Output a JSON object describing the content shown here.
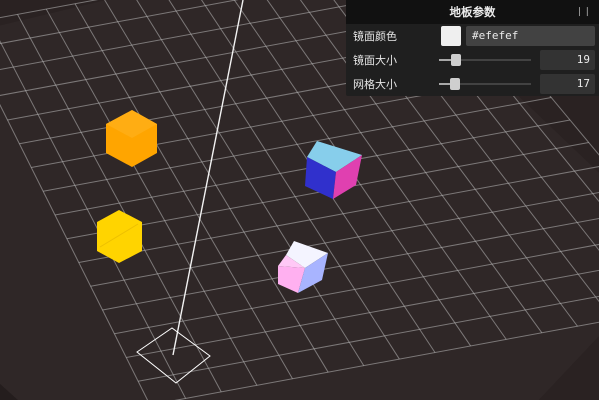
{
  "panel": {
    "title": "地板参数",
    "collapse_icon": "collapse-icon",
    "mirror_color": {
      "label": "镜面颜色",
      "value": "#efefef"
    },
    "mirror_size": {
      "label": "镜面大小",
      "value": "19",
      "level": 0.19
    },
    "grid_size": {
      "label": "网格大小",
      "value": "17",
      "level": 0.17
    }
  },
  "scene": {
    "floor_color": "#2f2727",
    "grid_color": "#bcbcbc",
    "background_color": "#2a2222",
    "objects": [
      {
        "name": "orange-hexagon",
        "color": "#ffa500"
      },
      {
        "name": "yellow-hexagon",
        "color": "#ffd400"
      },
      {
        "name": "blue-magenta-cube",
        "colors": [
          "#87ceeb",
          "#3030cc",
          "#e040b0"
        ]
      },
      {
        "name": "pink-white-cube",
        "colors": [
          "#f4f4ff",
          "#ffb0f0",
          "#a8b4ff"
        ]
      }
    ]
  }
}
